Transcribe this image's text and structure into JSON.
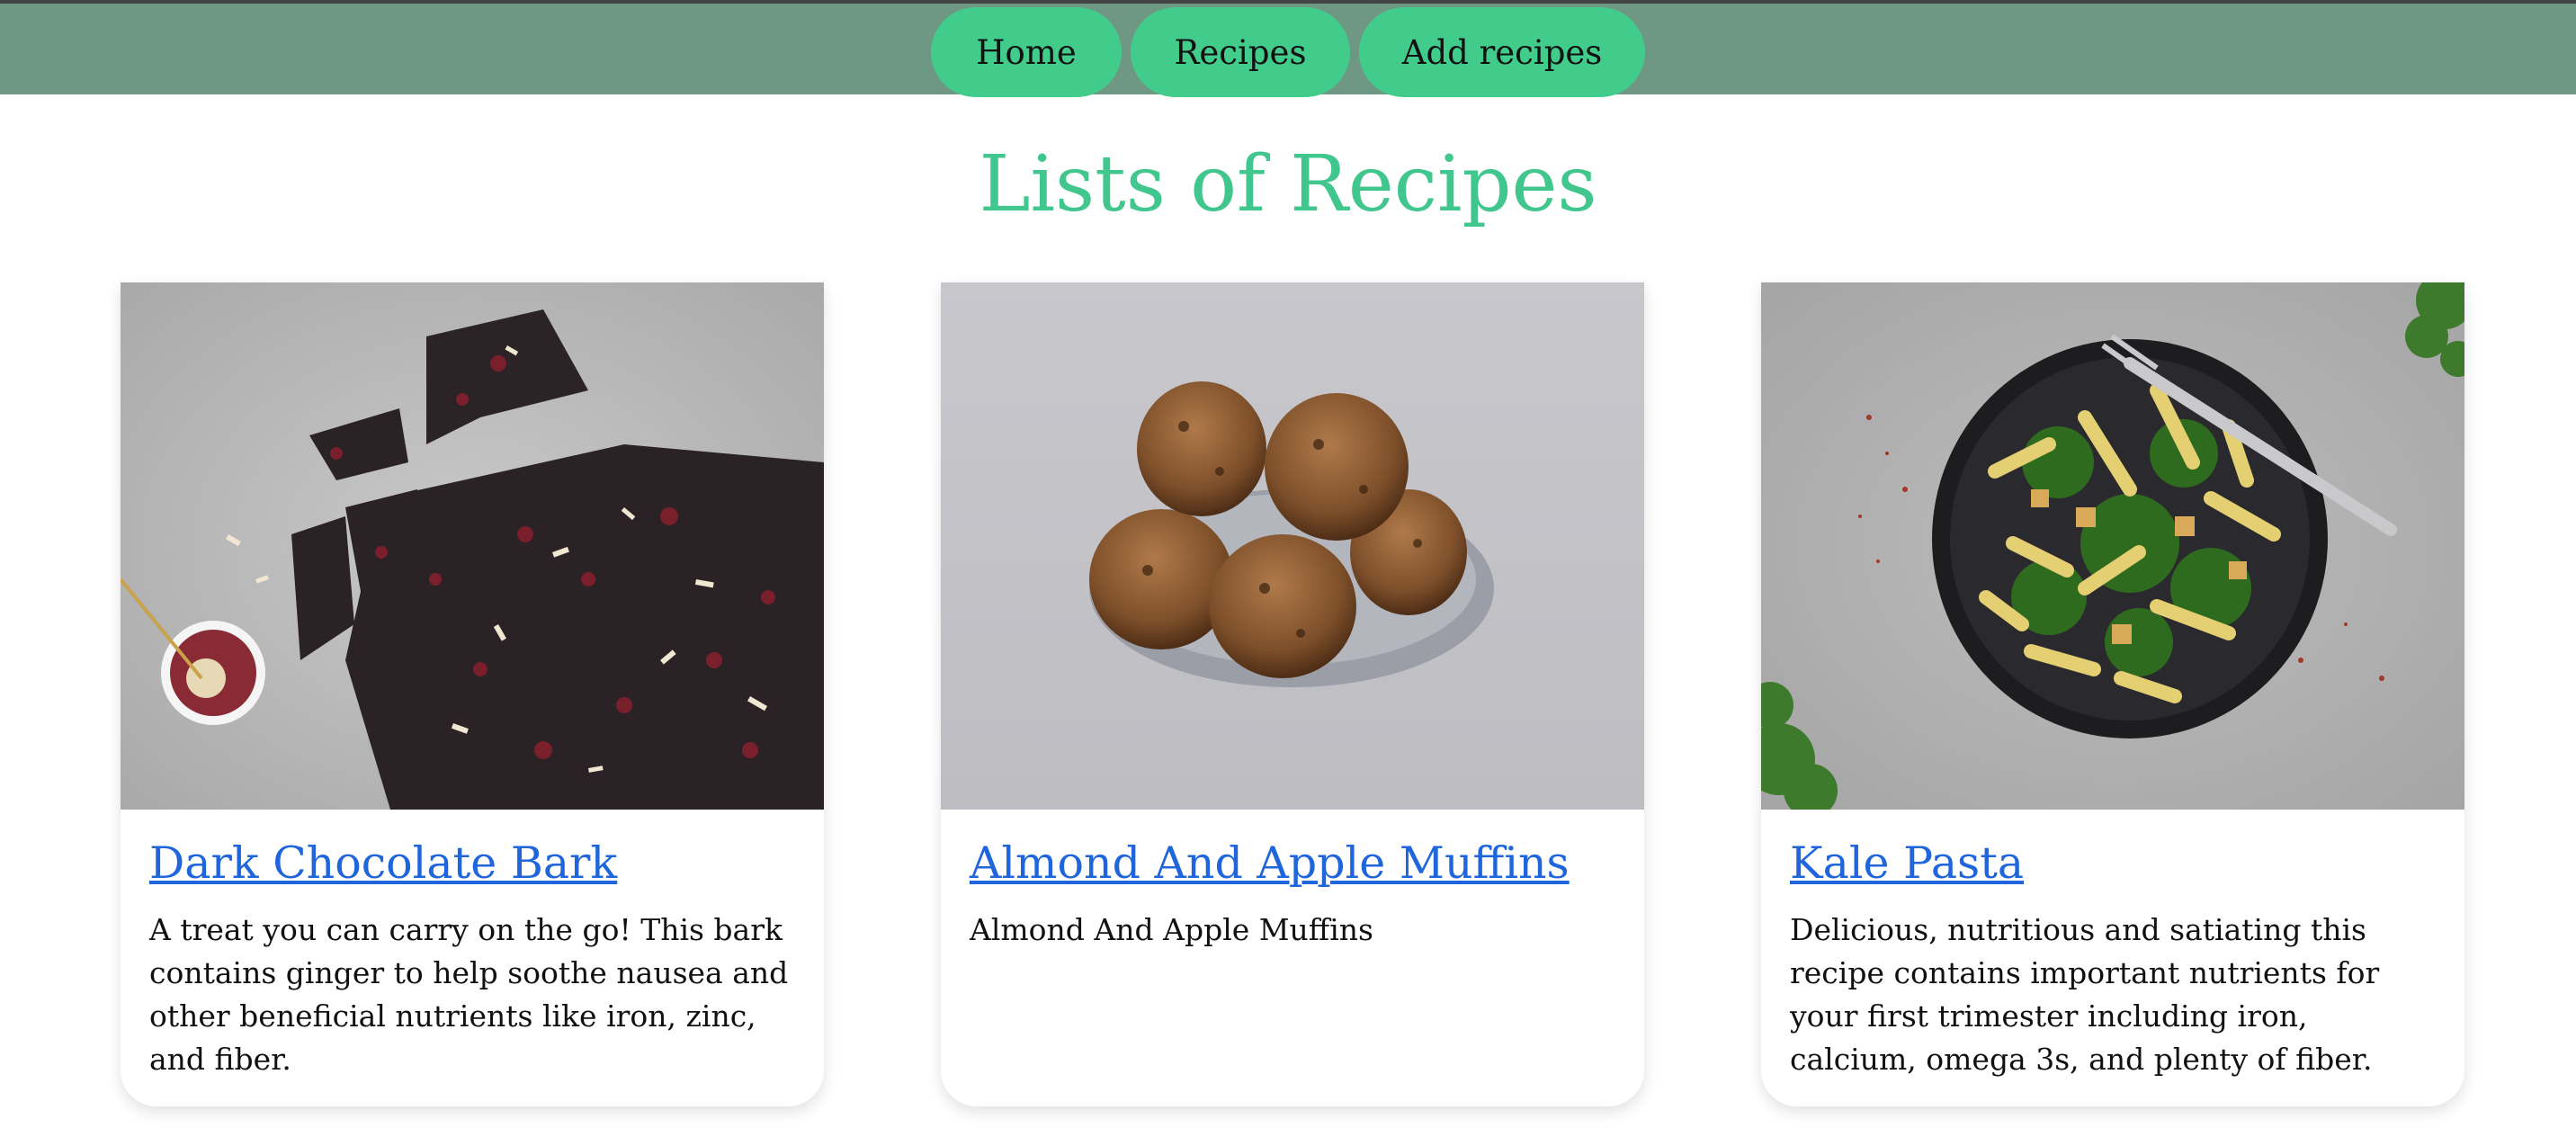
{
  "nav": {
    "items": [
      {
        "label": "Home"
      },
      {
        "label": "Recipes"
      },
      {
        "label": "Add recipes"
      }
    ]
  },
  "page": {
    "title": "Lists of Recipes"
  },
  "recipes": [
    {
      "title": "Dark Chocolate Bark",
      "description": "A treat you can carry on the go! This bark contains ginger to help soothe nausea and other beneficial nutrients like iron, zinc, and fiber."
    },
    {
      "title": "Almond And Apple Muffins",
      "description": "Almond And Apple Muffins"
    },
    {
      "title": "Kale Pasta",
      "description": "Delicious, nutritious and satiating this recipe contains important nutrients for your first trimester including iron, calcium, omega 3s, and plenty of fiber."
    }
  ],
  "colors": {
    "topbar": "#6f9884",
    "accent": "#41cc8c",
    "title": "#41c78d",
    "link": "#1f66dc"
  }
}
